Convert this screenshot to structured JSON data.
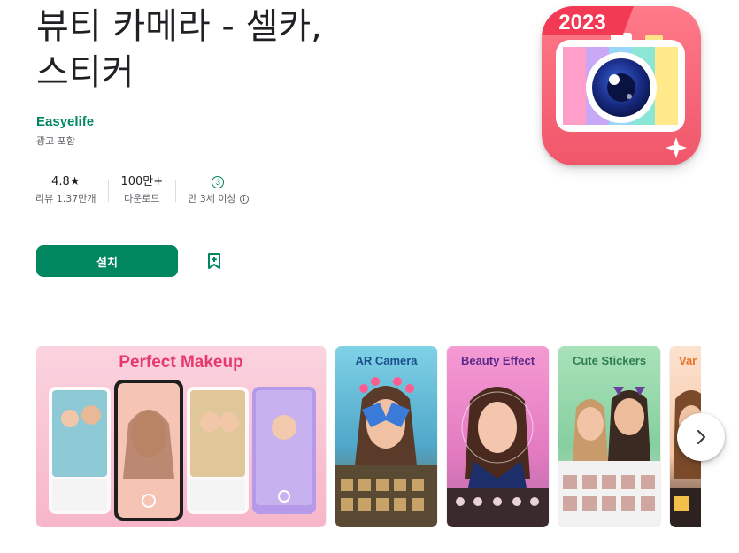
{
  "app": {
    "title_line1": "뷰티 카메라 - 셀카,",
    "title_line2": "스티커",
    "developer": "Easyelife",
    "ads_note": "광고 포함",
    "icon_badge": "2023"
  },
  "stats": {
    "rating": "4.8",
    "rating_star": "★",
    "reviews": "리뷰 1.37만개",
    "downloads": "100만+",
    "downloads_label": "다운로드",
    "age_badge": "3",
    "age_label": "만 3세 이상",
    "info_icon": "i"
  },
  "actions": {
    "install_label": "설치",
    "wishlist_icon": "bookmark-add-icon"
  },
  "screenshots": [
    {
      "caption": "Perfect Makeup",
      "caption_color": "#e5396b"
    },
    {
      "caption": "AR Camera",
      "caption_color": "#1b4f8a"
    },
    {
      "caption": "Beauty Effect",
      "caption_color": "#5a2a8a"
    },
    {
      "caption": "Cute Stickers",
      "caption_color": "#2e7d4f"
    },
    {
      "caption": "Var",
      "caption_color": "#e8742a"
    }
  ],
  "colors": {
    "accent": "#01875f",
    "text": "#202124",
    "muted": "#5f6368"
  }
}
